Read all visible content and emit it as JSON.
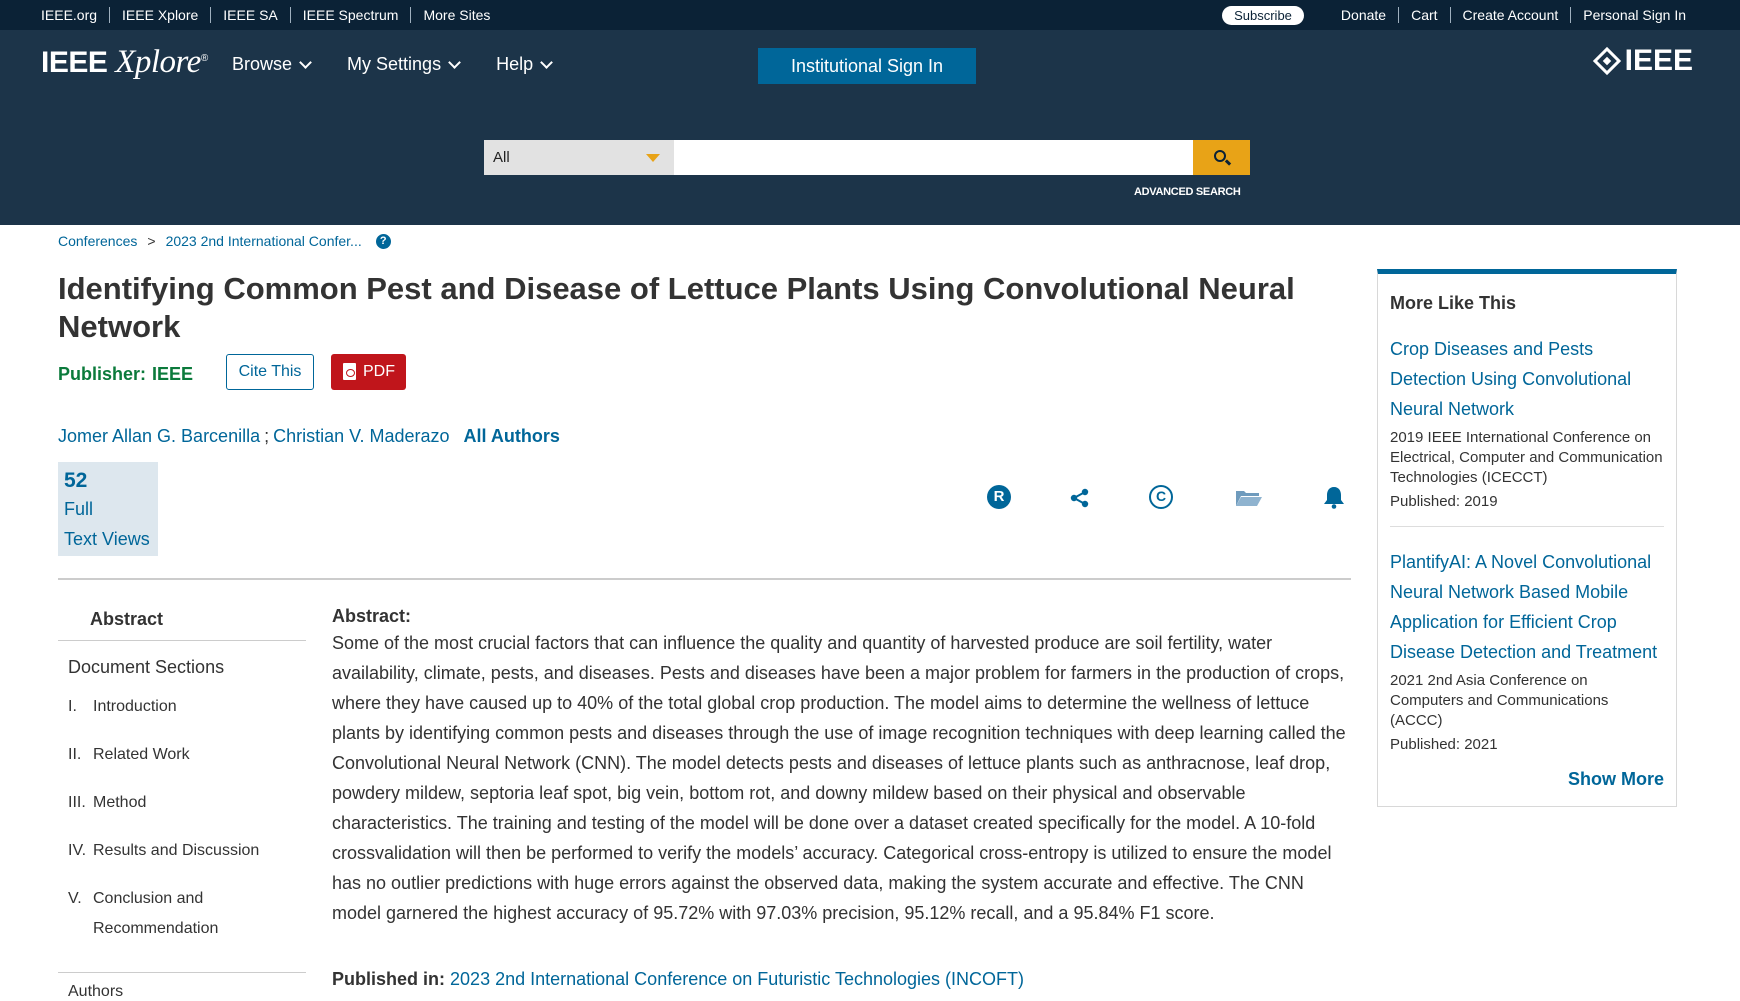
{
  "util_bar": {
    "left_links": [
      "IEEE.org",
      "IEEE Xplore",
      "IEEE SA",
      "IEEE Spectrum",
      "More Sites"
    ],
    "subscribe": "Subscribe",
    "right_links": [
      "Donate",
      "Cart",
      "Create Account",
      "Personal Sign In"
    ]
  },
  "header": {
    "logo_ieee": "IEEE",
    "logo_xplore": "Xplore",
    "logo_reg": "®",
    "nav": [
      "Browse",
      "My Settings",
      "Help"
    ],
    "inst_sign_in": "Institutional Sign In",
    "brand": "IEEE"
  },
  "search": {
    "scope": "All",
    "placeholder": "",
    "advanced": "ADVANCED SEARCH"
  },
  "breadcrumb": {
    "items": [
      "Conferences",
      "2023 2nd International Confer..."
    ],
    "separator": ">",
    "help": "?"
  },
  "doc": {
    "title": "Identifying Common Pest and Disease of Lettuce Plants Using Convolutional Neural Network",
    "publisher_label": "Publisher:",
    "publisher_value": "IEEE",
    "cite": "Cite This",
    "pdf": "PDF",
    "authors": [
      "Jomer Allan G. Barcenilla",
      "Christian V. Maderazo"
    ],
    "all_authors": "All Authors",
    "metrics": {
      "value": "52",
      "label_1": "Full",
      "label_2": "Text Views"
    },
    "action_icons": [
      "rights-icon",
      "share-icon",
      "copyright-icon",
      "folder-icon",
      "alert-bell-icon"
    ]
  },
  "sections": {
    "abstract": "Abstract",
    "document_sections": "Document Sections",
    "items": [
      {
        "num": "I.",
        "label": "Introduction"
      },
      {
        "num": "II.",
        "label": "Related Work"
      },
      {
        "num": "III.",
        "label": "Method"
      },
      {
        "num": "IV.",
        "label": "Results and Discussion"
      },
      {
        "num": "V.",
        "label": "Conclusion and Recommendation"
      }
    ],
    "authors_cut": "Authors"
  },
  "abstract": {
    "heading": "Abstract:",
    "text": "Some of the most crucial factors that can influence the quality and quantity of harvested produce are soil fertility, water availability, climate, pests, and diseases. Pests and diseases have been a major problem for farmers in the production of crops, where they have caused up to 40% of the total global crop production. The model aims to determine the wellness of lettuce plants by identifying common pests and diseases through the use of image recognition techniques with deep learning called the Convolutional Neural Network (CNN). The model detects pests and diseases of lettuce plants such as anthracnose, leaf drop, powdery mildew, septoria leaf spot, big vein, bottom rot, and downy mildew based on their physical and observable characteristics. The training and testing of the model will be done over a dataset created specifically for the model. A 10-fold crossvalidation will then be performed to verify the models’ accuracy. Categorical cross-entropy is utilized to ensure the model has no outlier predictions with huge errors against the observed data, making the system accurate and effective. The CNN model garnered the highest accuracy of 95.72% with 97.03% precision, 95.12% recall, and a 95.84% F1 score.",
    "published_in_label": "Published in:",
    "published_in_value": "2023 2nd International Conference on Futuristic Technologies (INCOFT)"
  },
  "more_like_this": {
    "title": "More Like This",
    "items": [
      {
        "link": "Crop Diseases and Pests Detection Using Convolutional Neural Network",
        "venue": "2019 IEEE International Conference on Electrical, Computer and Communication Technologies (ICECCT)",
        "published": "Published: 2019"
      },
      {
        "link": "PlantifyAI: A Novel Convolutional Neural Network Based Mobile Application for Efficient Crop Disease Detection and Treatment",
        "venue": "2021 2nd Asia Conference on Computers and Communications (ACCC)",
        "published": "Published: 2021"
      }
    ],
    "show_more": "Show More"
  },
  "colors": {
    "util_bar": "#0b2236",
    "header": "#1c3449",
    "link": "#006699",
    "search_button": "#e8a317",
    "pdf": "#c0151b",
    "publisher": "#0b7a3b"
  }
}
